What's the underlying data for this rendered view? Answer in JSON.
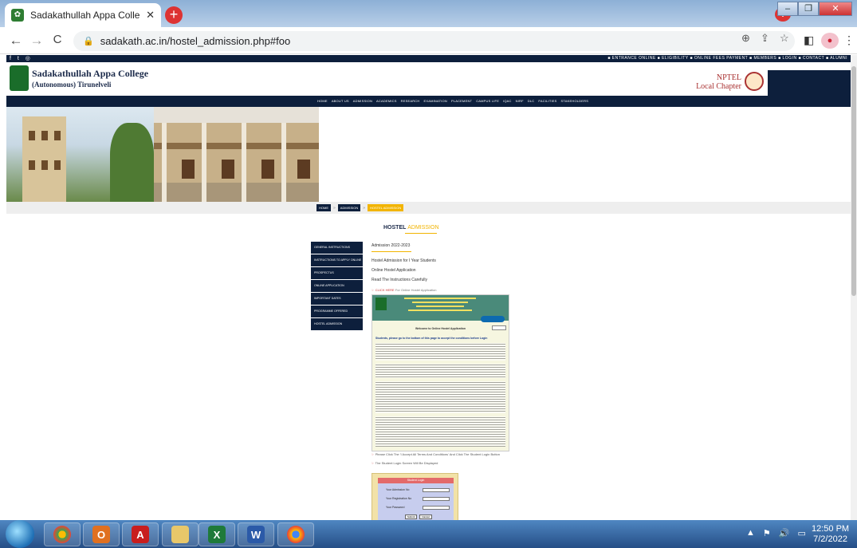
{
  "browser": {
    "tab_title": "Sadakathullah Appa College, Pal",
    "tab_close": "✕",
    "new_tab": "+",
    "url": "sadakath.ac.in/hostel_admission.php#foo",
    "nav": {
      "back": "←",
      "forward": "→",
      "reload": "C"
    },
    "lock_icon": "🔒",
    "toolbar_icons": {
      "zoom": "⊕",
      "share": "⇪",
      "star": "☆",
      "panel": "◧",
      "menu": "⋮"
    },
    "profile_initial": "●",
    "window_buttons": {
      "minimize": "–",
      "restore": "❐",
      "close": "✕"
    }
  },
  "site": {
    "social": "f  t  ◎",
    "toplinks": "■ ENTRANCE ONLINE   ■ ELIGIBILITY   ■ ONLINE FEES PAYMENT   ■ MEMBERS   ■ LOGIN   ■ CONTACT   ■ ALUMNI",
    "college_name": "Sadakathullah Appa College",
    "college_sub": "(Autonomous) Tirunelveli",
    "nptel_line1": "NPTEL",
    "nptel_line2": "Local Chapter",
    "mainnav": [
      "HOME",
      "ABOUT US",
      "ADMISSION",
      "ACADEMICS",
      "RESEARCH",
      "EXAMINATION",
      "PLACEMENT",
      "CAMPUS LIFE",
      "IQAC",
      "NIRF",
      "DLC",
      "FACILITIES",
      "STAKEHOLDERS"
    ],
    "breadcrumb": {
      "home": "HOME",
      "sep": "»",
      "admission": "ADMISSION",
      "current": "HOSTEL ADMISSION"
    },
    "section_title_part1": "HOSTEL",
    "section_title_part2": "ADMISSION",
    "sidemenu": [
      "GENERAL INSTRUCTIONS",
      "INSTRUCTIONS TO APPLY ONLINE",
      "PROSPECTUS",
      "ONLINE APPLICATION",
      "IMPORTANT DATES",
      "PROGRAMME OFFERED",
      "HOSTEL ADMISSION"
    ],
    "content": {
      "year": "Admission 2022-2023",
      "line1": "Hostel Admission for I Year Students",
      "line2": "Online Hostel Application",
      "line3": "Read The Instructions Carefully",
      "click_label": "CLICK HERE",
      "click_rest": "For Online Hostel Application"
    },
    "app_screenshot": {
      "welcome": "Welcome to Online Hostel Application",
      "note": "Students, please go to the bottom of this page to accept the conditions before Login"
    },
    "note1_prefix": "☞",
    "note1": "Please Click The 'I Accept All Terms And Conditions' And Click The Student Login Button",
    "note2_prefix": "☞",
    "note2": "The Student Login Screen Will Be Displayed",
    "login": {
      "head": "Student Login",
      "fields": [
        "Your Admission No",
        "Your Registration No",
        "Your Password"
      ],
      "submit": "Submit",
      "cancel": "Cancel"
    }
  },
  "taskbar": {
    "apps": [
      "chrome",
      "outlook",
      "acrobat",
      "explorer",
      "excel",
      "word",
      "chrome-alt"
    ],
    "tray": [
      "▲",
      "⚑",
      "🔊",
      "▭"
    ],
    "time": "12:50 PM",
    "date": "7/2/2022"
  },
  "colors": {
    "navy": "#0d1f3c",
    "accent": "#f2b400"
  }
}
